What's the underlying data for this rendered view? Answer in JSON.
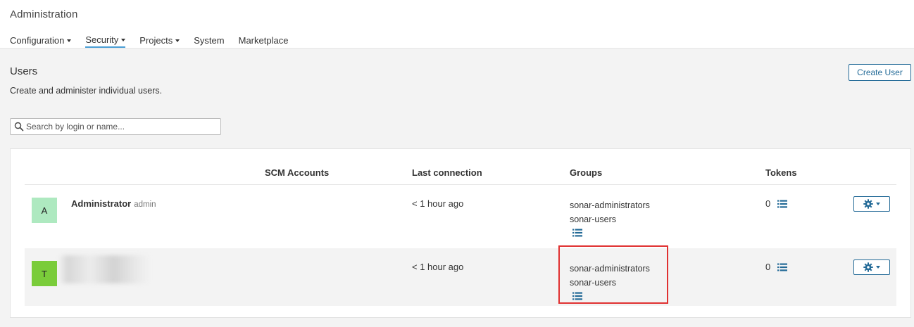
{
  "header": {
    "title": "Administration",
    "nav": [
      {
        "label": "Configuration",
        "dropdown": true,
        "active": false
      },
      {
        "label": "Security",
        "dropdown": true,
        "active": true
      },
      {
        "label": "Projects",
        "dropdown": true,
        "active": false
      },
      {
        "label": "System",
        "dropdown": false,
        "active": false
      },
      {
        "label": "Marketplace",
        "dropdown": false,
        "active": false
      }
    ]
  },
  "page": {
    "title": "Users",
    "description": "Create and administer individual users.",
    "create_button": "Create User"
  },
  "search": {
    "placeholder": "Search by login or name...",
    "value": ""
  },
  "table": {
    "columns": {
      "scm": "SCM Accounts",
      "last_connection": "Last connection",
      "groups": "Groups",
      "tokens": "Tokens"
    },
    "rows": [
      {
        "avatar_letter": "A",
        "avatar_color": "#aee9c0",
        "name": "Administrator",
        "login": "admin",
        "last_connection": "< 1 hour ago",
        "groups": [
          "sonar-administrators",
          "sonar-users"
        ],
        "tokens": "0"
      },
      {
        "avatar_letter": "T",
        "avatar_color": "#7acc3a",
        "name": "",
        "login": "",
        "last_connection": "< 1 hour ago",
        "groups": [
          "sonar-administrators",
          "sonar-users"
        ],
        "tokens": "0"
      }
    ]
  },
  "colors": {
    "accent": "#236a97",
    "nav_underline": "#4b9fd5",
    "highlight": "#e03131",
    "background": "#f3f3f3"
  },
  "icons": {
    "search": "search-icon",
    "list": "list-icon",
    "gear": "gear-icon"
  }
}
